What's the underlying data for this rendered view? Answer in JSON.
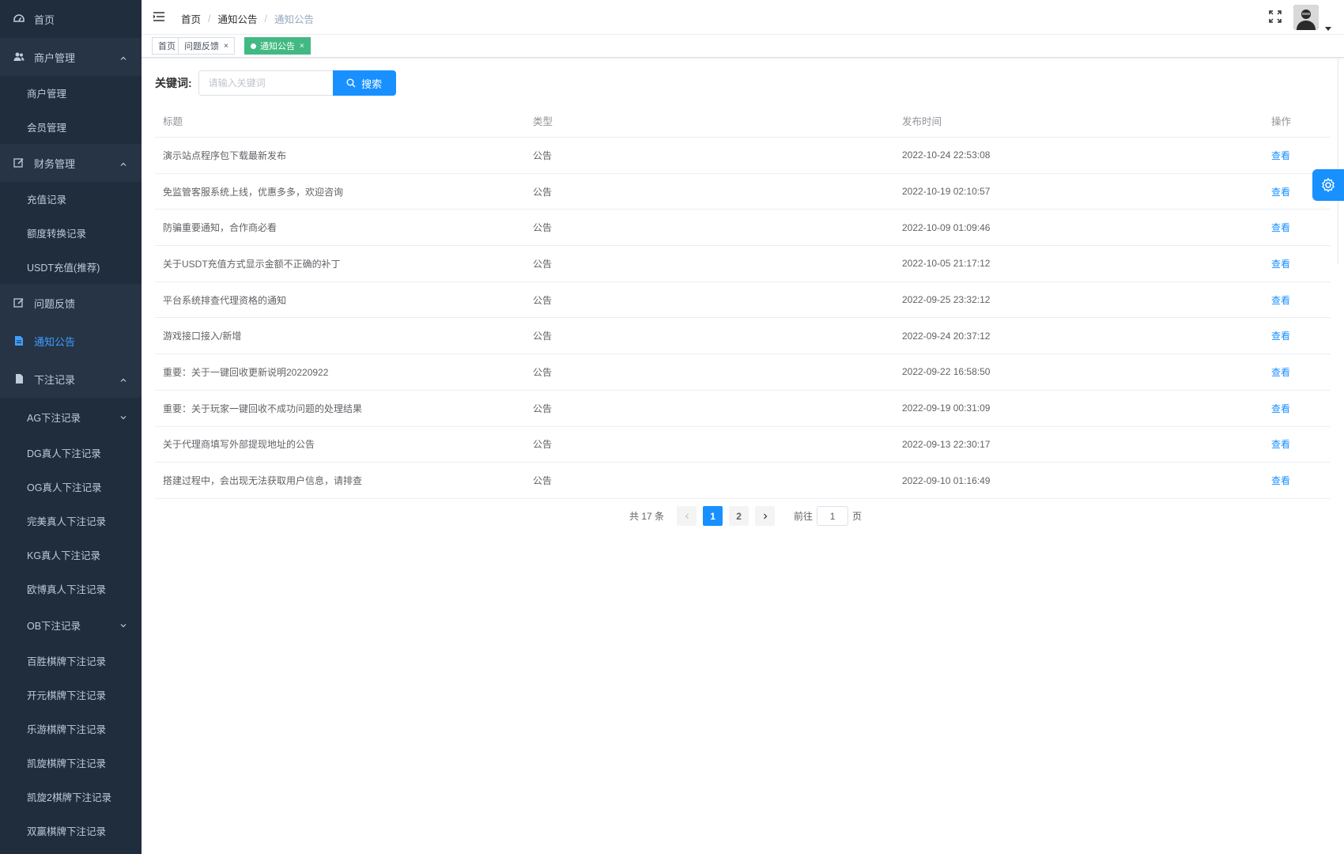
{
  "sidebar": {
    "home": "首页",
    "merchant": "商户管理",
    "merchant_children": [
      "商户管理",
      "会员管理"
    ],
    "finance": "财务管理",
    "finance_children": [
      "充值记录",
      "额度转换记录",
      "USDT充值(推荐)"
    ],
    "feedback": "问题反馈",
    "notice": "通知公告",
    "bets": "下注记录",
    "bets_children": [
      "AG下注记录",
      "DG真人下注记录",
      "OG真人下注记录",
      "完美真人下注记录",
      "KG真人下注记录",
      "欧博真人下注记录",
      "OB下注记录",
      "百胜棋牌下注记录",
      "开元棋牌下注记录",
      "乐游棋牌下注记录",
      "凯旋棋牌下注记录",
      "凯旋2棋牌下注记录",
      "双赢棋牌下注记录"
    ]
  },
  "breadcrumb": [
    "首页",
    "通知公告",
    "通知公告"
  ],
  "tags": [
    {
      "label": "首页"
    },
    {
      "label": "问题反馈",
      "close": "×"
    },
    {
      "label": "通知公告",
      "close": "×"
    }
  ],
  "filter": {
    "label": "关键词:",
    "placeholder": "请输入关键词",
    "search_label": "搜索"
  },
  "table": {
    "headers": [
      "标题",
      "类型",
      "发布时间",
      "操作"
    ],
    "rows": [
      {
        "title": "演示站点程序包下载最新发布",
        "type": "公告",
        "time": "2022-10-24 22:53:08",
        "op": "查看"
      },
      {
        "title": "免监管客服系统上线，优惠多多，欢迎咨询",
        "type": "公告",
        "time": "2022-10-19 02:10:57",
        "op": "查看"
      },
      {
        "title": "防骗重要通知，合作商必看",
        "type": "公告",
        "time": "2022-10-09 01:09:46",
        "op": "查看"
      },
      {
        "title": "关于USDT充值方式显示金额不正确的补丁",
        "type": "公告",
        "time": "2022-10-05 21:17:12",
        "op": "查看"
      },
      {
        "title": "平台系统排查代理资格的通知",
        "type": "公告",
        "time": "2022-09-25 23:32:12",
        "op": "查看"
      },
      {
        "title": "游戏接口接入/新增",
        "type": "公告",
        "time": "2022-09-24 20:37:12",
        "op": "查看"
      },
      {
        "title": "重要：关于一键回收更新说明20220922",
        "type": "公告",
        "time": "2022-09-22 16:58:50",
        "op": "查看"
      },
      {
        "title": "重要：关于玩家一键回收不成功问题的处理结果",
        "type": "公告",
        "time": "2022-09-19 00:31:09",
        "op": "查看"
      },
      {
        "title": "关于代理商填写外部提现地址的公告",
        "type": "公告",
        "time": "2022-09-13 22:30:17",
        "op": "查看"
      },
      {
        "title": "搭建过程中，会出现无法获取用户信息，请排查",
        "type": "公告",
        "time": "2022-09-10 01:16:49",
        "op": "查看"
      }
    ]
  },
  "pagination": {
    "total_text": "共 17 条",
    "pages": [
      "1",
      "2"
    ],
    "current": "1",
    "goto_label": "前往",
    "goto_value": "1",
    "page_suffix": "页"
  },
  "colors": {
    "sidebar_bg": "#1f2d3d",
    "sidebar_parent_bg": "#263445",
    "primary": "#1890ff",
    "active_tag": "#42b983",
    "menu_active": "#409eff"
  }
}
